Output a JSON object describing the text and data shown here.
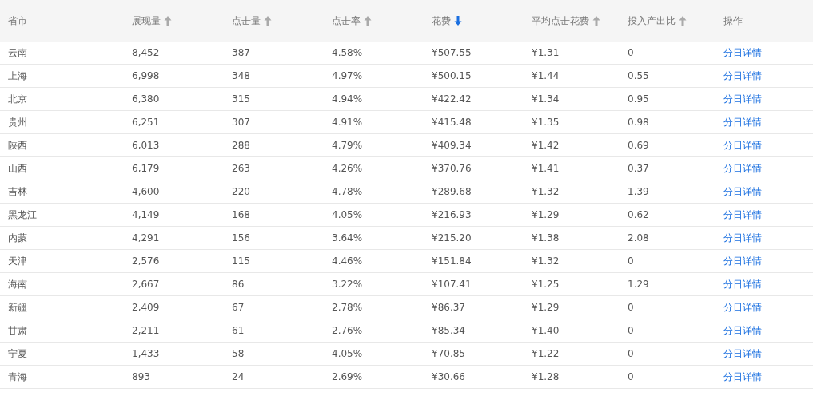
{
  "columns": [
    {
      "label": "省市",
      "sortable": false
    },
    {
      "label": "展现量",
      "sortable": true,
      "sorted": false
    },
    {
      "label": "点击量",
      "sortable": true,
      "sorted": false
    },
    {
      "label": "点击率",
      "sortable": true,
      "sorted": false
    },
    {
      "label": "花费",
      "sortable": true,
      "sorted": true
    },
    {
      "label": "平均点击花费",
      "sortable": true,
      "sorted": false
    },
    {
      "label": "投入产出比",
      "sortable": true,
      "sorted": false
    },
    {
      "label": "操作",
      "sortable": false
    }
  ],
  "rows": [
    {
      "cells": [
        "云南",
        "8,452",
        "387",
        "4.58%",
        "¥507.55",
        "¥1.31",
        "0"
      ],
      "link": "分日详情"
    },
    {
      "cells": [
        "上海",
        "6,998",
        "348",
        "4.97%",
        "¥500.15",
        "¥1.44",
        "0.55"
      ],
      "link": "分日详情"
    },
    {
      "cells": [
        "北京",
        "6,380",
        "315",
        "4.94%",
        "¥422.42",
        "¥1.34",
        "0.95"
      ],
      "link": "分日详情"
    },
    {
      "cells": [
        "贵州",
        "6,251",
        "307",
        "4.91%",
        "¥415.48",
        "¥1.35",
        "0.98"
      ],
      "link": "分日详情"
    },
    {
      "cells": [
        "陕西",
        "6,013",
        "288",
        "4.79%",
        "¥409.34",
        "¥1.42",
        "0.69"
      ],
      "link": "分日详情"
    },
    {
      "cells": [
        "山西",
        "6,179",
        "263",
        "4.26%",
        "¥370.76",
        "¥1.41",
        "0.37"
      ],
      "link": "分日详情"
    },
    {
      "cells": [
        "吉林",
        "4,600",
        "220",
        "4.78%",
        "¥289.68",
        "¥1.32",
        "1.39"
      ],
      "link": "分日详情"
    },
    {
      "cells": [
        "黑龙江",
        "4,149",
        "168",
        "4.05%",
        "¥216.93",
        "¥1.29",
        "0.62"
      ],
      "link": "分日详情"
    },
    {
      "cells": [
        "内蒙",
        "4,291",
        "156",
        "3.64%",
        "¥215.20",
        "¥1.38",
        "2.08"
      ],
      "link": "分日详情"
    },
    {
      "cells": [
        "天津",
        "2,576",
        "115",
        "4.46%",
        "¥151.84",
        "¥1.32",
        "0"
      ],
      "link": "分日详情"
    },
    {
      "cells": [
        "海南",
        "2,667",
        "86",
        "3.22%",
        "¥107.41",
        "¥1.25",
        "1.29"
      ],
      "link": "分日详情"
    },
    {
      "cells": [
        "新疆",
        "2,409",
        "67",
        "2.78%",
        "¥86.37",
        "¥1.29",
        "0"
      ],
      "link": "分日详情"
    },
    {
      "cells": [
        "甘肃",
        "2,211",
        "61",
        "2.76%",
        "¥85.34",
        "¥1.40",
        "0"
      ],
      "link": "分日详情"
    },
    {
      "cells": [
        "宁夏",
        "1,433",
        "58",
        "4.05%",
        "¥70.85",
        "¥1.22",
        "0"
      ],
      "link": "分日详情"
    },
    {
      "cells": [
        "青海",
        "893",
        "24",
        "2.69%",
        "¥30.66",
        "¥1.28",
        "0"
      ],
      "link": "分日详情"
    }
  ]
}
